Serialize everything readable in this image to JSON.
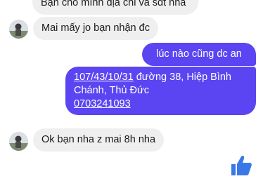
{
  "messages": [
    {
      "text": "Bạn cho mình địa chỉ và sđt nha"
    },
    {
      "text": "Mai mấy jo bạn nhận đc"
    },
    {
      "text": "lúc nào cũng dc an"
    },
    {
      "line1_link": "107/43/10/31",
      "line1_rest": " đường 38, Hiệp Bình",
      "line2": "Chánh, Thủ Đức",
      "line3_link": "0703241093"
    },
    {
      "text": "Ok bạn nha z mai 8h nha"
    }
  ],
  "colors": {
    "outgoing": "#5b45f2",
    "incoming": "#efefef",
    "like": "#3b78e7"
  },
  "icons": {
    "like": "thumbs-up-icon"
  }
}
